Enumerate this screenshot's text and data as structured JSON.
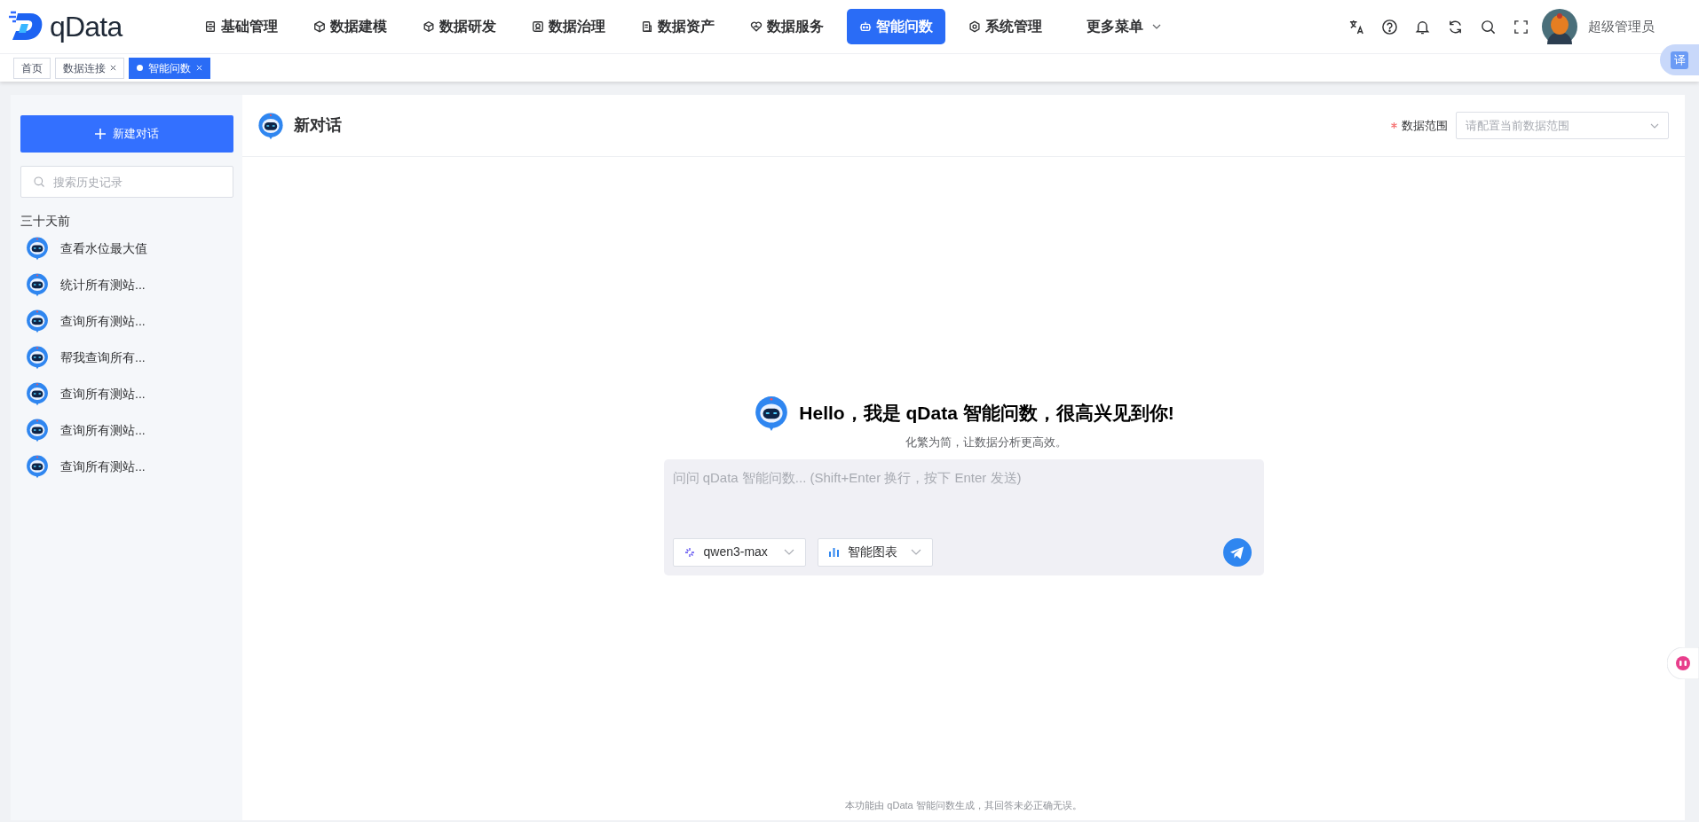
{
  "header": {
    "logo": "qData",
    "nav": [
      {
        "label": "基础管理",
        "selected": false
      },
      {
        "label": "数据建模",
        "selected": false
      },
      {
        "label": "数据研发",
        "selected": false
      },
      {
        "label": "数据治理",
        "selected": false
      },
      {
        "label": "数据资产",
        "selected": false
      },
      {
        "label": "数据服务",
        "selected": false
      },
      {
        "label": "智能问数",
        "selected": true
      },
      {
        "label": "系统管理",
        "selected": false
      }
    ],
    "more_menu": "更多菜单",
    "user": "超级管理员"
  },
  "tabs": [
    {
      "label": "首页",
      "closable": false,
      "selected": false
    },
    {
      "label": "数据连接",
      "closable": true,
      "selected": false
    },
    {
      "label": "智能问数",
      "closable": true,
      "selected": true
    }
  ],
  "sidebar": {
    "new_button": "新建对话",
    "search_placeholder": "搜索历史记录",
    "group_label": "三十天前",
    "items": [
      "查看水位最大值",
      "统计所有测站...",
      "查询所有测站...",
      "帮我查询所有...",
      "查询所有测站...",
      "查询所有测站...",
      "查询所有测站..."
    ]
  },
  "chat": {
    "title": "新对话",
    "scope_label": "数据范围",
    "scope_required": true,
    "scope_placeholder": "请配置当前数据范围",
    "greeting": "Hello，我是 qData 智能问数，很高兴见到你!",
    "subtitle": "化繁为简，让数据分析更高效。",
    "input_placeholder": "问问 qData 智能问数... (Shift+Enter 换行，按下 Enter 发送)",
    "model": "qwen3-max",
    "mode": "智能图表",
    "disclaimer": "本功能由 qData 智能问数生成，其回答未必正确无误。"
  },
  "floating_translate": "译"
}
